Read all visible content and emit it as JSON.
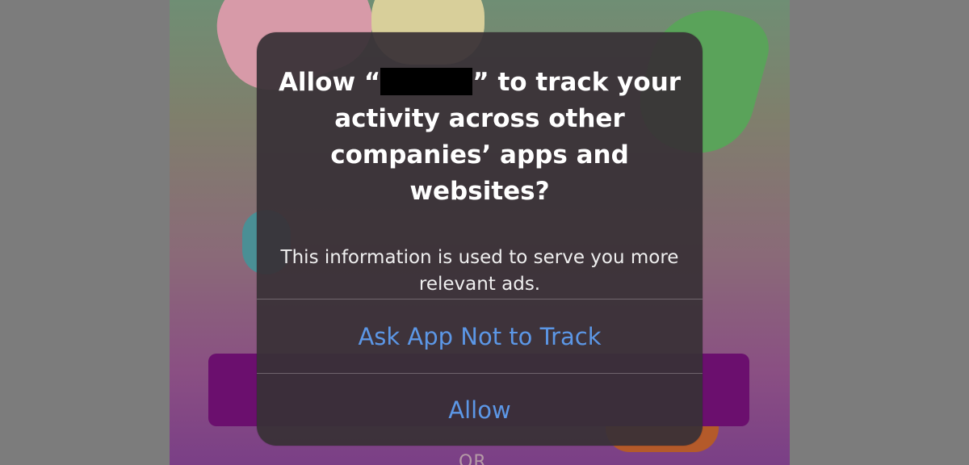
{
  "dialog": {
    "title_prefix": "Allow “",
    "title_suffix": "” to track your activity across other companies’ apps and websites?",
    "message": "This information is used to serve you more relevant ads.",
    "buttons": {
      "ask_not_to_track": "Ask App Not to Track",
      "allow": "Allow"
    }
  },
  "background": {
    "or_text": "OR"
  },
  "colors": {
    "dialog_background": "#383036",
    "button_text": "#5c97e6",
    "title_text": "#ffffff",
    "redaction": "#000000",
    "background_button": "#6b0f6e"
  }
}
